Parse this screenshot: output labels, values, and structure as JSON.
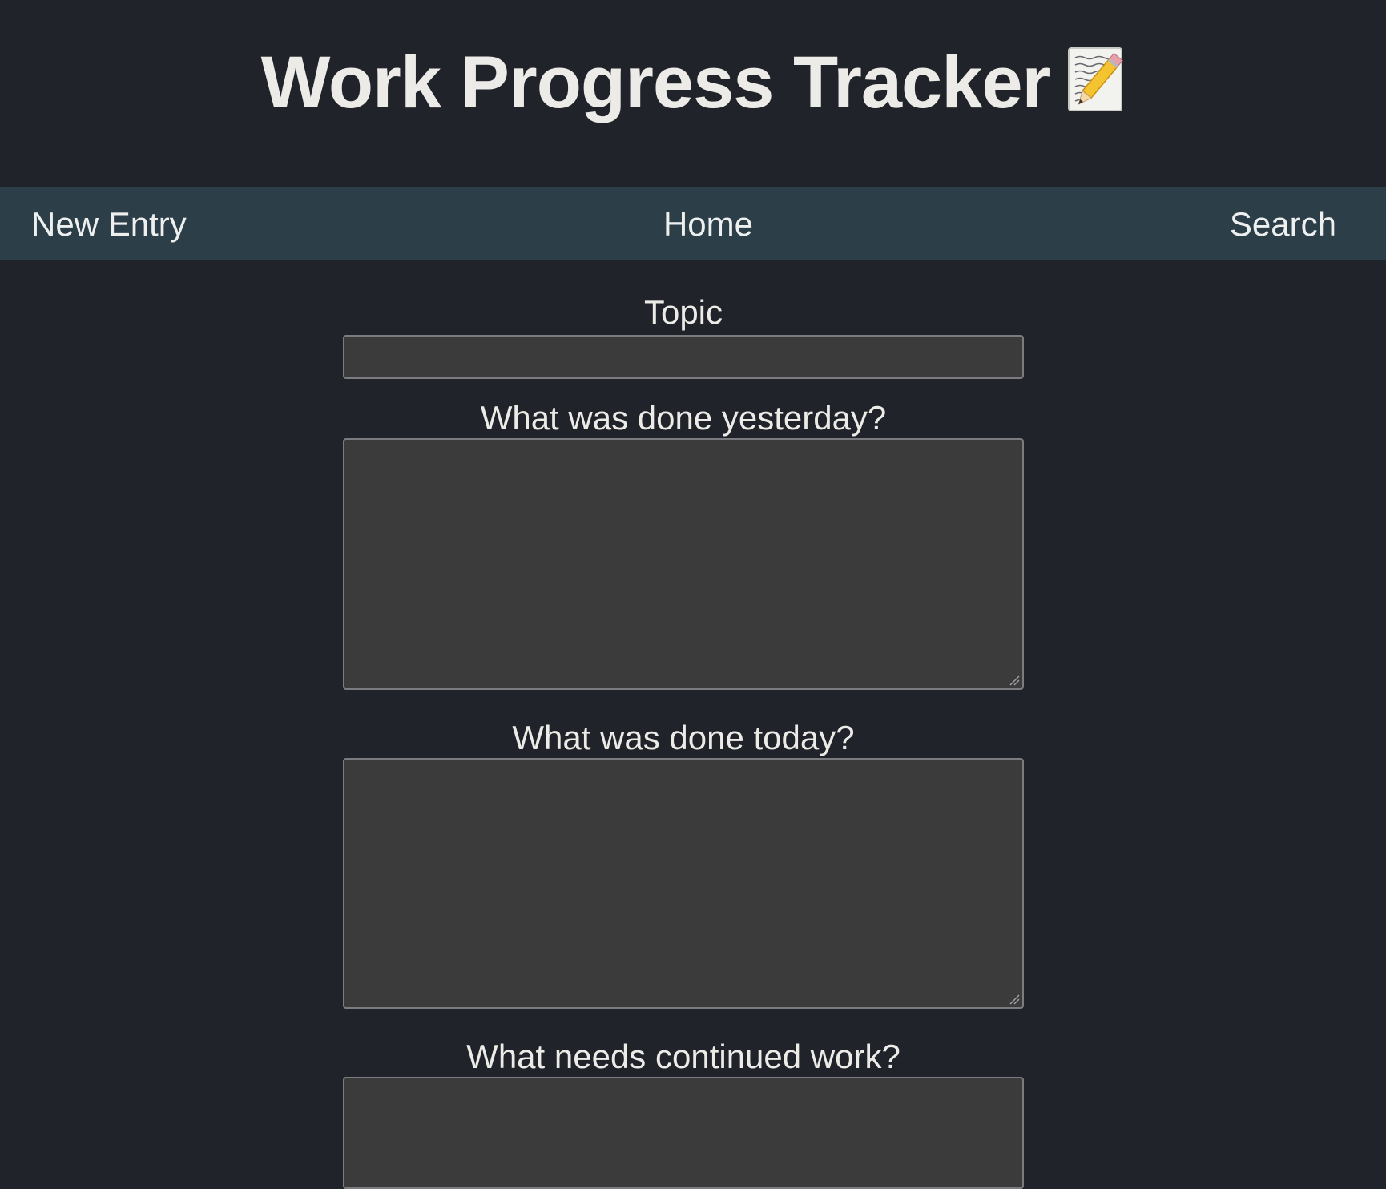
{
  "app": {
    "title": "Work Progress Tracker",
    "title_icon": "memo-pencil-icon"
  },
  "nav": {
    "new_entry": "New Entry",
    "home": "Home",
    "search": "Search"
  },
  "form": {
    "topic_label": "Topic",
    "topic_value": "",
    "yesterday_label": "What was done yesterday?",
    "yesterday_value": "",
    "today_label": "What was done today?",
    "today_value": "",
    "continued_label": "What needs continued work?",
    "continued_value": ""
  },
  "colors": {
    "background": "#202329",
    "nav_background": "#2c3e48",
    "field_background": "#3b3b3c",
    "field_border": "#7c7c80",
    "text": "#ecebe7"
  }
}
